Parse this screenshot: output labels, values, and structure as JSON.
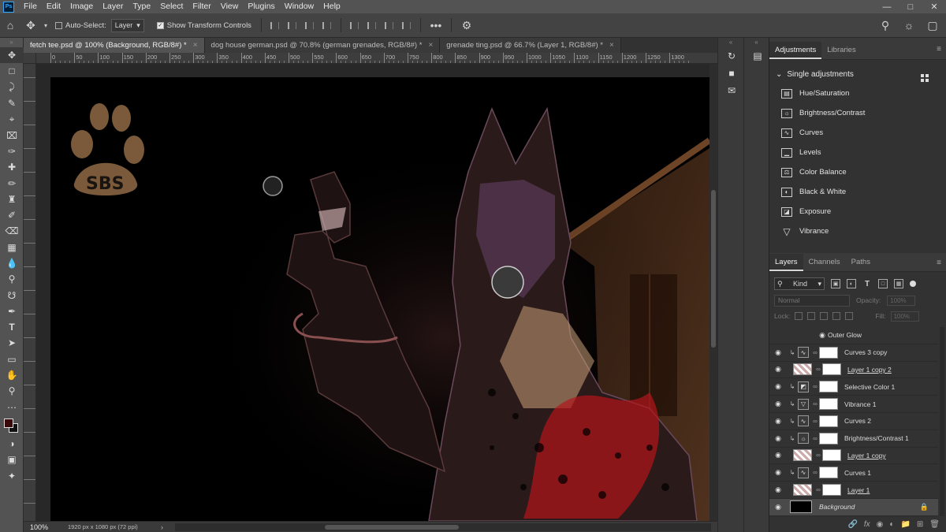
{
  "app": {
    "logo": "Ps"
  },
  "menu": [
    "File",
    "Edit",
    "Image",
    "Layer",
    "Type",
    "Select",
    "Filter",
    "View",
    "Plugins",
    "Window",
    "Help"
  ],
  "window_controls": [
    "minimize-icon",
    "maximize-icon",
    "close-icon"
  ],
  "options_bar": {
    "auto_select_label": "Auto-Select:",
    "auto_select_checked": false,
    "auto_select_target": "Layer",
    "show_transform_label": "Show Transform Controls",
    "show_transform_checked": true,
    "more_label": "•••"
  },
  "tabs": [
    {
      "label": "fetch tee.psd @ 100% (Background, RGB/8#) *",
      "active": true
    },
    {
      "label": "dog house german.psd @ 70.8% (german grenades, RGB/8#) *",
      "active": false
    },
    {
      "label": "grenade ting.psd @ 66.7% (Layer 1, RGB/8#) *",
      "active": false
    }
  ],
  "ruler": {
    "labels": [
      "100",
      "50",
      "0",
      "50",
      "100",
      "150",
      "200",
      "250",
      "300",
      "350",
      "400",
      "450",
      "500",
      "550",
      "600",
      "650",
      "700",
      "750",
      "800",
      "850",
      "900",
      "950",
      "1000",
      "1050",
      "1100",
      "1150",
      "1200",
      "1250",
      "1300"
    ]
  },
  "canvas": {
    "logo_text": "SBS",
    "colors": {
      "fur_tan": "#c9a07a",
      "bandana_red": "#b3161b",
      "paw_brown": "#7a5a3a",
      "shed_wood": "#5a3a22"
    }
  },
  "status": {
    "zoom": "100%",
    "doc_info": "1920 px x 1080 px (72 ppi)",
    "arrow": "›"
  },
  "foreground_color": "#3a0a0a",
  "background_color": "#111111",
  "adjustments_panel": {
    "tabs": [
      "Adjustments",
      "Libraries"
    ],
    "header": "Single adjustments",
    "items": [
      {
        "label": "Hue/Saturation",
        "icon": "hue-saturation-icon"
      },
      {
        "label": "Brightness/Contrast",
        "icon": "brightness-icon"
      },
      {
        "label": "Curves",
        "icon": "curves-icon"
      },
      {
        "label": "Levels",
        "icon": "levels-icon"
      },
      {
        "label": "Color Balance",
        "icon": "color-balance-icon"
      },
      {
        "label": "Black & White",
        "icon": "black-white-icon"
      },
      {
        "label": "Exposure",
        "icon": "exposure-icon"
      },
      {
        "label": "Vibrance",
        "icon": "vibrance-icon"
      }
    ]
  },
  "layers_panel": {
    "tabs": [
      "Layers",
      "Channels",
      "Paths"
    ],
    "filter_kind": "Kind",
    "blend_mode": "Normal",
    "opacity_label": "Opacity:",
    "opacity_value": "100%",
    "lock_label": "Lock:",
    "fill_label": "Fill:",
    "fill_value": "100%",
    "layers": [
      {
        "name": "Outer Glow",
        "type": "effect"
      },
      {
        "name": "Curves 3 copy",
        "type": "adjustment",
        "icon": "curves-icon",
        "clipped": true
      },
      {
        "name": "Layer 1 copy 2",
        "type": "pixel",
        "underline": true
      },
      {
        "name": "Selective Color 1",
        "type": "adjustment",
        "icon": "selective-color-icon",
        "clipped": true
      },
      {
        "name": "Vibrance 1",
        "type": "adjustment",
        "icon": "vibrance-icon",
        "clipped": true
      },
      {
        "name": "Curves 2",
        "type": "adjustment",
        "icon": "curves-icon",
        "clipped": true
      },
      {
        "name": "Brightness/Contrast 1",
        "type": "adjustment",
        "icon": "brightness-icon",
        "clipped": true
      },
      {
        "name": "Layer 1 copy",
        "type": "pixel",
        "underline": true
      },
      {
        "name": "Curves 1",
        "type": "adjustment",
        "icon": "curves-icon",
        "clipped": true
      },
      {
        "name": "Layer 1",
        "type": "pixel",
        "underline": true
      },
      {
        "name": "Background",
        "type": "background",
        "italic": true,
        "selected": true,
        "locked": true
      }
    ]
  }
}
